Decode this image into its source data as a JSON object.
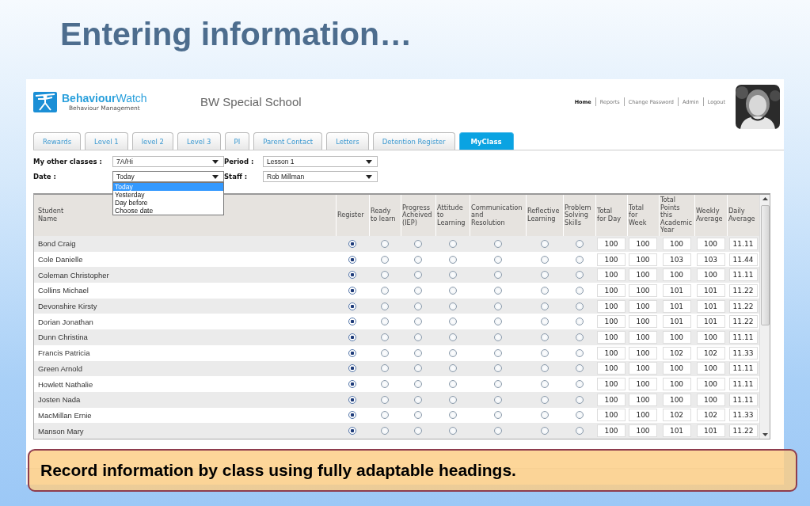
{
  "slide": {
    "title": "Entering information…",
    "callout": "Record information by class using fully adaptable headings."
  },
  "app": {
    "logo": {
      "brand": "**Behaviour**Watch",
      "tagline": "Behaviour Management"
    },
    "school": "BW Special School",
    "nav": [
      {
        "label": "Home",
        "selected": true
      },
      {
        "label": "Reports",
        "selected": false
      },
      {
        "label": "Change Password",
        "selected": false
      },
      {
        "label": "Admin",
        "selected": false
      },
      {
        "label": "Logout",
        "selected": false
      }
    ],
    "tabs": [
      {
        "label": "Rewards",
        "selected": false
      },
      {
        "label": "Level 1",
        "selected": false
      },
      {
        "label": "level 2",
        "selected": false
      },
      {
        "label": "Level 3",
        "selected": false
      },
      {
        "label": "PI",
        "selected": false
      },
      {
        "label": "Parent Contact",
        "selected": false
      },
      {
        "label": "Letters",
        "selected": false
      },
      {
        "label": "Detention Register",
        "selected": false
      },
      {
        "label": "MyClass",
        "selected": true
      }
    ],
    "filters": [
      {
        "label": "My other classes :",
        "value": "7A/Hi",
        "expanded": false
      },
      {
        "label": "Period :",
        "value": "Lesson 1",
        "expanded": false
      },
      {
        "label": "Date :",
        "value": "Today",
        "expanded": true,
        "options": [
          {
            "label": "Today",
            "selected": true
          },
          {
            "label": "Yesterday",
            "selected": false
          },
          {
            "label": "Day before",
            "selected": false
          },
          {
            "label": "Choose date",
            "selected": false
          }
        ]
      },
      {
        "label": "Staff :",
        "value": "Rob Millman",
        "expanded": false
      }
    ],
    "table": {
      "columns": [
        "Student\nName",
        "Register",
        "Ready\nto learn",
        "Progress\nAcheived\n(IEP)",
        "Attitude\nto\nLearning",
        "Communication\nand\nResolution",
        "Reflective\nLearning",
        "Problem\nSolving\nSkills",
        "Total\nfor Day",
        "Total\nfor\nWeek",
        "Total\nPoints\nthis\nAcademic\nYear",
        "Weekly\nAverage",
        "Daily\nAverage"
      ],
      "rows": [
        {
          "name": "Bond Craig",
          "radios": [
            true,
            false,
            false,
            false,
            false,
            false,
            false
          ],
          "values": [
            "100",
            "100",
            "100",
            "100",
            "11.11"
          ]
        },
        {
          "name": "Cole Danielle",
          "radios": [
            true,
            false,
            false,
            false,
            false,
            false,
            false
          ],
          "values": [
            "100",
            "100",
            "103",
            "103",
            "11.44"
          ]
        },
        {
          "name": "Coleman Christopher",
          "radios": [
            true,
            false,
            false,
            false,
            false,
            false,
            false
          ],
          "values": [
            "100",
            "100",
            "100",
            "100",
            "11.11"
          ]
        },
        {
          "name": "Collins Michael",
          "radios": [
            true,
            false,
            false,
            false,
            false,
            false,
            false
          ],
          "values": [
            "100",
            "100",
            "101",
            "101",
            "11.22"
          ]
        },
        {
          "name": "Devonshire Kirsty",
          "radios": [
            true,
            false,
            false,
            false,
            false,
            false,
            false
          ],
          "values": [
            "100",
            "100",
            "101",
            "101",
            "11.22"
          ]
        },
        {
          "name": "Dorian Jonathan",
          "radios": [
            true,
            false,
            false,
            false,
            false,
            false,
            false
          ],
          "values": [
            "100",
            "100",
            "101",
            "101",
            "11.22"
          ]
        },
        {
          "name": "Dunn Christina",
          "radios": [
            true,
            false,
            false,
            false,
            false,
            false,
            false
          ],
          "values": [
            "100",
            "100",
            "100",
            "100",
            "11.11"
          ]
        },
        {
          "name": "Francis Patricia",
          "radios": [
            true,
            false,
            false,
            false,
            false,
            false,
            false
          ],
          "values": [
            "100",
            "100",
            "102",
            "102",
            "11.33"
          ]
        },
        {
          "name": "Green Arnold",
          "radios": [
            true,
            false,
            false,
            false,
            false,
            false,
            false
          ],
          "values": [
            "100",
            "100",
            "100",
            "100",
            "11.11"
          ]
        },
        {
          "name": "Howlett Nathalie",
          "radios": [
            true,
            false,
            false,
            false,
            false,
            false,
            false
          ],
          "values": [
            "100",
            "100",
            "100",
            "100",
            "11.11"
          ]
        },
        {
          "name": "Josten Nada",
          "radios": [
            true,
            false,
            false,
            false,
            false,
            false,
            false
          ],
          "values": [
            "100",
            "100",
            "100",
            "100",
            "11.11"
          ]
        },
        {
          "name": "MacMillan Ernie",
          "radios": [
            true,
            false,
            false,
            false,
            false,
            false,
            false
          ],
          "values": [
            "100",
            "100",
            "102",
            "102",
            "11.33"
          ]
        },
        {
          "name": "Manson Mary",
          "radios": [
            true,
            false,
            false,
            false,
            false,
            false,
            false
          ],
          "values": [
            "100",
            "100",
            "101",
            "101",
            "11.22"
          ]
        }
      ]
    }
  }
}
